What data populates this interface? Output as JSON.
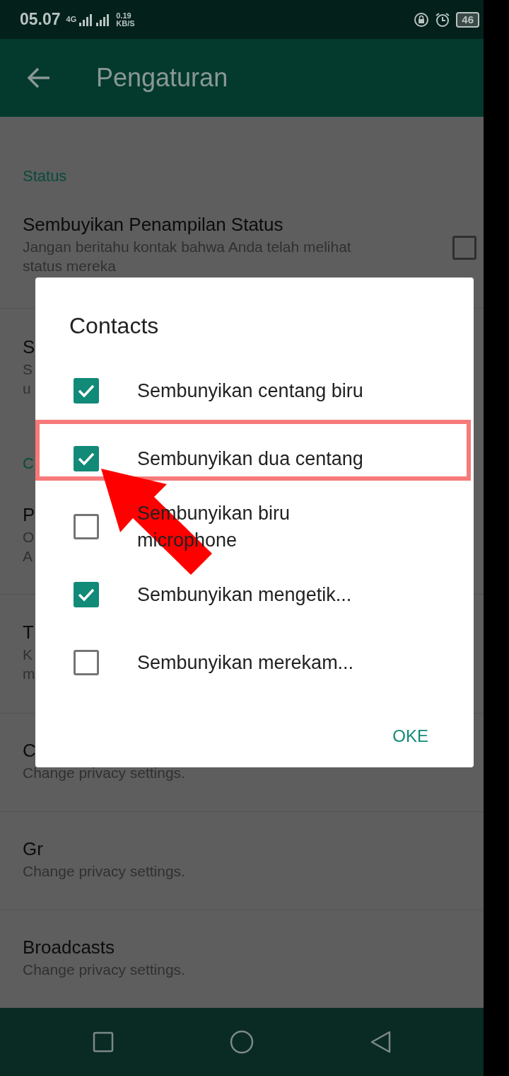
{
  "status_bar": {
    "time": "05.07",
    "network": "4G",
    "speed": "0.19",
    "speed_unit": "KB/S",
    "battery": "46"
  },
  "app_bar": {
    "title": "Pengaturan"
  },
  "settings": [
    {
      "kind": "header",
      "title": "Status"
    },
    {
      "kind": "toggle",
      "title": "Sembuyikan Penampilan Status",
      "subtitle": [
        "Jangan beritahu kontak bahwa Anda telah melihat",
        "status mereka"
      ],
      "checked": false
    },
    {
      "kind": "plain",
      "title": "S",
      "subtitle": [
        "S",
        "u"
      ]
    },
    {
      "kind": "header",
      "title": "C"
    },
    {
      "kind": "plain",
      "title": "P",
      "subtitle": [
        "O",
        "A"
      ]
    },
    {
      "kind": "plain",
      "title": "T",
      "subtitle": [
        "K",
        "m"
      ]
    },
    {
      "kind": "plain",
      "title": "C",
      "subtitle": [
        "Change privacy settings."
      ]
    },
    {
      "kind": "plain",
      "title": "Gr",
      "subtitle": [
        "Change privacy settings."
      ]
    },
    {
      "kind": "plain",
      "title": "Broadcasts",
      "subtitle": [
        "Change privacy settings."
      ]
    }
  ],
  "dialog": {
    "title": "Contacts",
    "options": [
      {
        "label": "Sembunyikan centang biru",
        "checked": true,
        "highlighted": false
      },
      {
        "label": "Sembunyikan dua centang",
        "checked": true,
        "highlighted": true
      },
      {
        "label": "Sembunyikan biru microphone",
        "checked": false,
        "highlighted": false
      },
      {
        "label": "Sembunyikan mengetik...",
        "checked": true,
        "highlighted": false
      },
      {
        "label": "Sembunyikan merekam...",
        "checked": false,
        "highlighted": false
      }
    ],
    "button": "OKE"
  }
}
